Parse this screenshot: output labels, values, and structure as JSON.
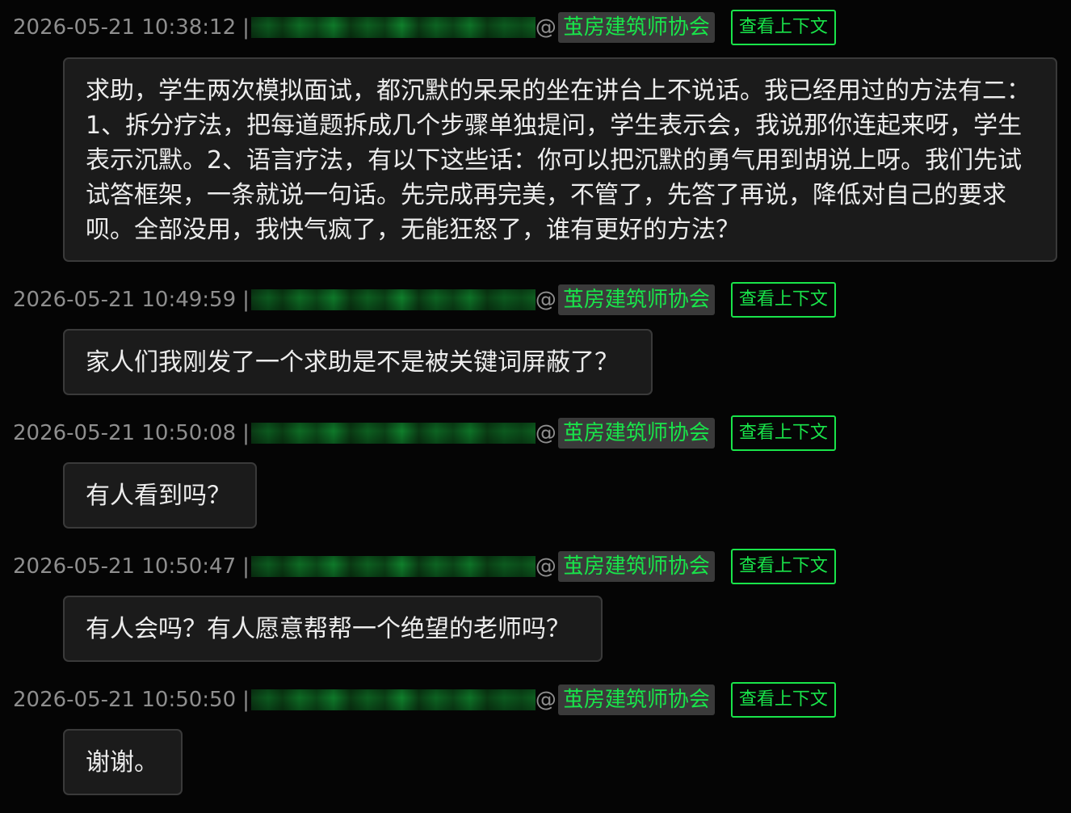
{
  "messages": [
    {
      "timestamp": "2026-05-21 10:38:12",
      "separator": "|",
      "at": "@",
      "group": "茧房建筑师协会",
      "context_label": "查看上下文",
      "text": "求助，学生两次模拟面试，都沉默的呆呆的坐在讲台上不说话。我已经用过的方法有二：1、拆分疗法，把每道题拆成几个步骤单独提问，学生表示会，我说那你连起来呀，学生表示沉默。2、语言疗法，有以下这些话：你可以把沉默的勇气用到胡说上呀。我们先试试答框架，一条就说一句话。先完成再完美，不管了，先答了再说，降低对自己的要求呗。全部没用，我快气疯了，无能狂怒了，谁有更好的方法？"
    },
    {
      "timestamp": "2026-05-21 10:49:59",
      "separator": "|",
      "at": "@",
      "group": "茧房建筑师协会",
      "context_label": "查看上下文",
      "text": "家人们我刚发了一个求助是不是被关键词屏蔽了？"
    },
    {
      "timestamp": "2026-05-21 10:50:08",
      "separator": "|",
      "at": "@",
      "group": "茧房建筑师协会",
      "context_label": "查看上下文",
      "text": "有人看到吗？"
    },
    {
      "timestamp": "2026-05-21 10:50:47",
      "separator": "|",
      "at": "@",
      "group": "茧房建筑师协会",
      "context_label": "查看上下文",
      "text": "有人会吗？有人愿意帮帮一个绝望的老师吗？"
    },
    {
      "timestamp": "2026-05-21 10:50:50",
      "separator": "|",
      "at": "@",
      "group": "茧房建筑师协会",
      "context_label": "查看上下文",
      "text": "谢谢。"
    }
  ]
}
